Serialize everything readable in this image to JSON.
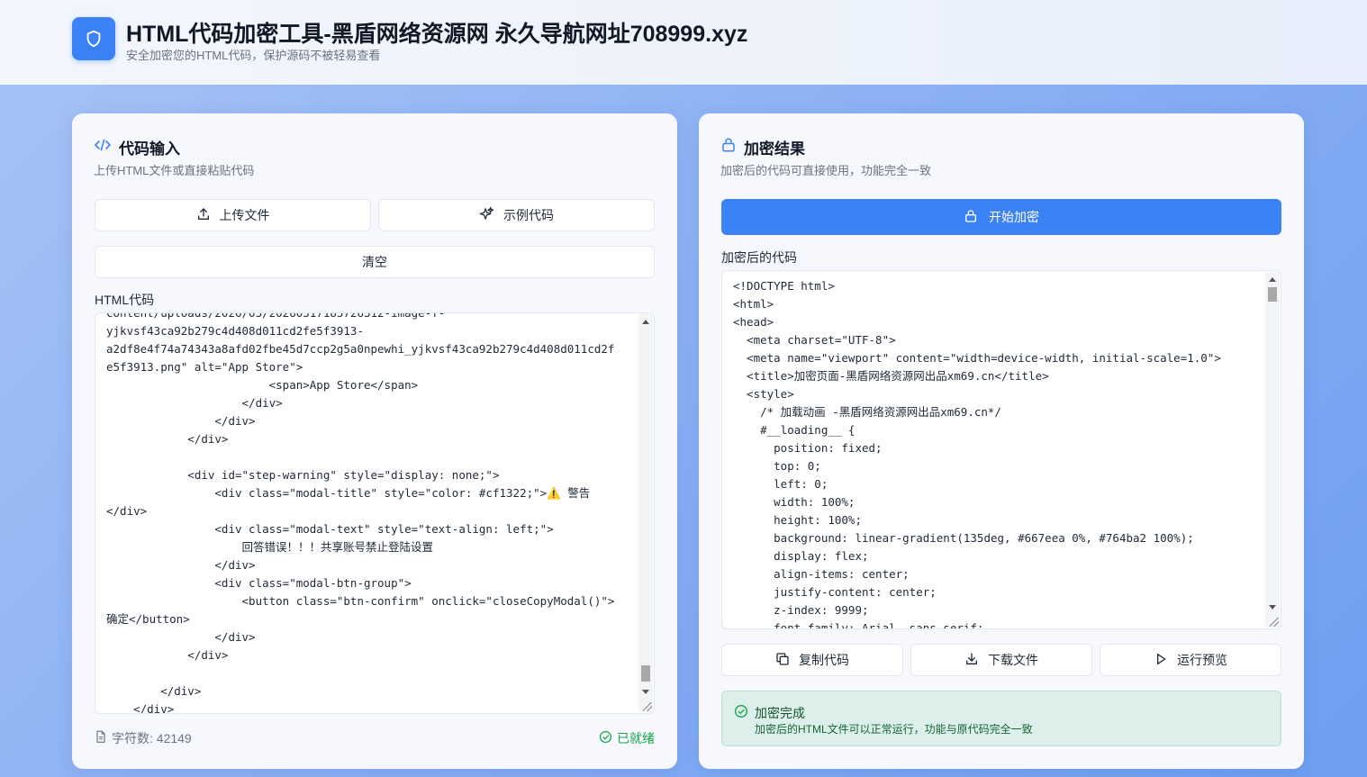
{
  "header": {
    "title": "HTML代码加密工具-黑盾网络资源网 永久导航网址708999.xyz",
    "subtitle": "安全加密您的HTML代码，保护源码不被轻易查看"
  },
  "input_panel": {
    "title": "代码输入",
    "description": "上传HTML文件或直接粘贴代码",
    "upload_label": "上传文件",
    "example_label": "示例代码",
    "clear_label": "清空",
    "code_label": "HTML代码",
    "code": "content/uploads/2026/03/20260317185726312-image-f-\nyjkvsf43ca92b279c4d408d011cd2fe5f3913-\na2df8e4f74a74343a8afd02fbe45d7ccp2g5a0npewhi_yjkvsf43ca92b279c4d408d011cd2f\ne5f3913.png\" alt=\"App Store\">\n                        <span>App Store</span>\n                    </div>\n                </div>\n            </div>\n\n            <div id=\"step-warning\" style=\"display: none;\">\n                <div class=\"modal-title\" style=\"color: #cf1322;\">⚠️ 警告\n</div>\n                <div class=\"modal-text\" style=\"text-align: left;\">\n                    回答错误！！！共享账号禁止登陆设置\n                </div>\n                <div class=\"modal-btn-group\">\n                    <button class=\"btn-confirm\" onclick=\"closeCopyModal()\">\n确定</button>\n                </div>\n            </div>\n\n        </div>\n    </div>",
    "char_count": "字符数: 42149",
    "status": "已就绪"
  },
  "output_panel": {
    "title": "加密结果",
    "description": "加密后的代码可直接使用，功能完全一致",
    "encrypt_label": "开始加密",
    "code_label": "加密后的代码",
    "code": "<!DOCTYPE html>\n<html>\n<head>\n  <meta charset=\"UTF-8\">\n  <meta name=\"viewport\" content=\"width=device-width, initial-scale=1.0\">\n  <title>加密页面-黑盾网络资源网出品xm69.cn</title>\n  <style>\n    /* 加载动画 -黑盾网络资源网出品xm69.cn*/\n    #__loading__ {\n      position: fixed;\n      top: 0;\n      left: 0;\n      width: 100%;\n      height: 100%;\n      background: linear-gradient(135deg, #667eea 0%, #764ba2 100%);\n      display: flex;\n      align-items: center;\n      justify-content: center;\n      z-index: 9999;\n      font-family: Arial, sans-serif;",
    "copy_label": "复制代码",
    "download_label": "下载文件",
    "preview_label": "运行预览",
    "success_title": "加密完成",
    "success_message": "加密后的HTML文件可以正常运行，功能与原代码完全一致"
  },
  "colors": {
    "primary": "#3b82f6",
    "success": "#16a34a",
    "success_bg": "#dcefeb"
  },
  "icons": {
    "logo": "shield-icon",
    "input_title": "code-icon",
    "output_title": "lock-icon",
    "upload": "upload-icon",
    "example": "sparkles-icon",
    "char_count": "file-icon",
    "status": "check-circle-icon",
    "copy": "copy-icon",
    "download": "download-icon",
    "preview": "play-icon"
  }
}
